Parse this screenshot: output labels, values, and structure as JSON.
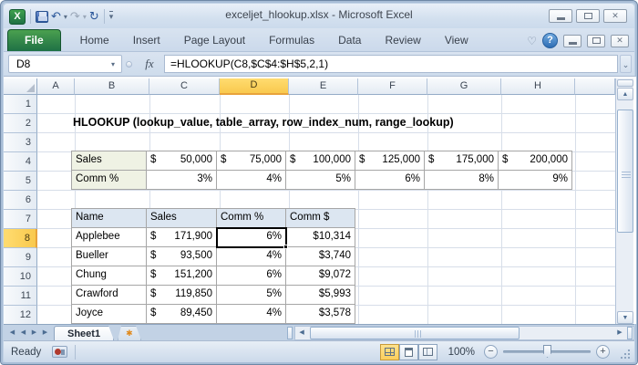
{
  "window": {
    "title": "exceljet_hlookup.xlsx - Microsoft Excel"
  },
  "icons": {
    "excel_logo": "X",
    "undo": "↶",
    "redo": "↷",
    "repeat": "↻",
    "dropdown": "▾",
    "ribbon_toggle": "♡",
    "help": "?",
    "close": "✕",
    "namebox_dropdown": "▾",
    "fx": "fx",
    "formula_expand": "⌄",
    "scroll_up": "▲",
    "scroll_down": "▼",
    "scroll_left": "◀",
    "scroll_right": "▶",
    "sheet_first": "◀▮",
    "sheet_prev": "◀",
    "sheet_next": "▶",
    "sheet_last": "▮▶",
    "insert_sheet_star": "✱",
    "zoom_out": "−",
    "zoom_in": "+"
  },
  "ribbon": {
    "file_tab": "File",
    "tabs": [
      "Home",
      "Insert",
      "Page Layout",
      "Formulas",
      "Data",
      "Review",
      "View"
    ]
  },
  "formula_bar": {
    "name_box": "D8",
    "formula": "=HLOOKUP(C8,$C$4:$H$5,2,1)"
  },
  "grid": {
    "columns": [
      "A",
      "B",
      "C",
      "D",
      "E",
      "F",
      "G",
      "H"
    ],
    "active_column": "D",
    "row_numbers": [
      "1",
      "2",
      "3",
      "4",
      "5",
      "6",
      "7",
      "8",
      "9",
      "10",
      "11",
      "12"
    ],
    "active_row": "8",
    "active_cell": "D8",
    "sheet_title": "HLOOKUP (lookup_value, table_array, row_index_num, range_lookup)",
    "currency": "$",
    "rate_table": {
      "labels": [
        "Sales",
        "Comm %"
      ],
      "sales_values": [
        "50,000",
        "75,000",
        "100,000",
        "125,000",
        "175,000",
        "200,000"
      ],
      "comm_values": [
        "3%",
        "4%",
        "5%",
        "6%",
        "8%",
        "9%"
      ]
    },
    "data_table": {
      "headers": [
        "Name",
        "Sales",
        "Comm %",
        "Comm $"
      ],
      "rows": [
        {
          "name": "Applebee",
          "sales": "171,900",
          "comm_pct": "6%",
          "comm_dollar": "$10,314"
        },
        {
          "name": "Bueller",
          "sales": "93,500",
          "comm_pct": "4%",
          "comm_dollar": "$3,740"
        },
        {
          "name": "Chung",
          "sales": "151,200",
          "comm_pct": "6%",
          "comm_dollar": "$9,072"
        },
        {
          "name": "Crawford",
          "sales": "119,850",
          "comm_pct": "5%",
          "comm_dollar": "$5,993"
        },
        {
          "name": "Joyce",
          "sales": "89,450",
          "comm_pct": "4%",
          "comm_dollar": "$3,578"
        }
      ]
    }
  },
  "sheet_bar": {
    "active_tab": "Sheet1"
  },
  "status_bar": {
    "mode": "Ready",
    "zoom_level": "100%"
  },
  "colors": {
    "active_header_fill": "#F9C94E",
    "file_tab_green": "#1E7145",
    "help_blue": "#2E6DB4",
    "rate_label_fill": "#EFF2E4",
    "table_header_fill": "#DCE6F1",
    "selection_border": "#000000"
  }
}
